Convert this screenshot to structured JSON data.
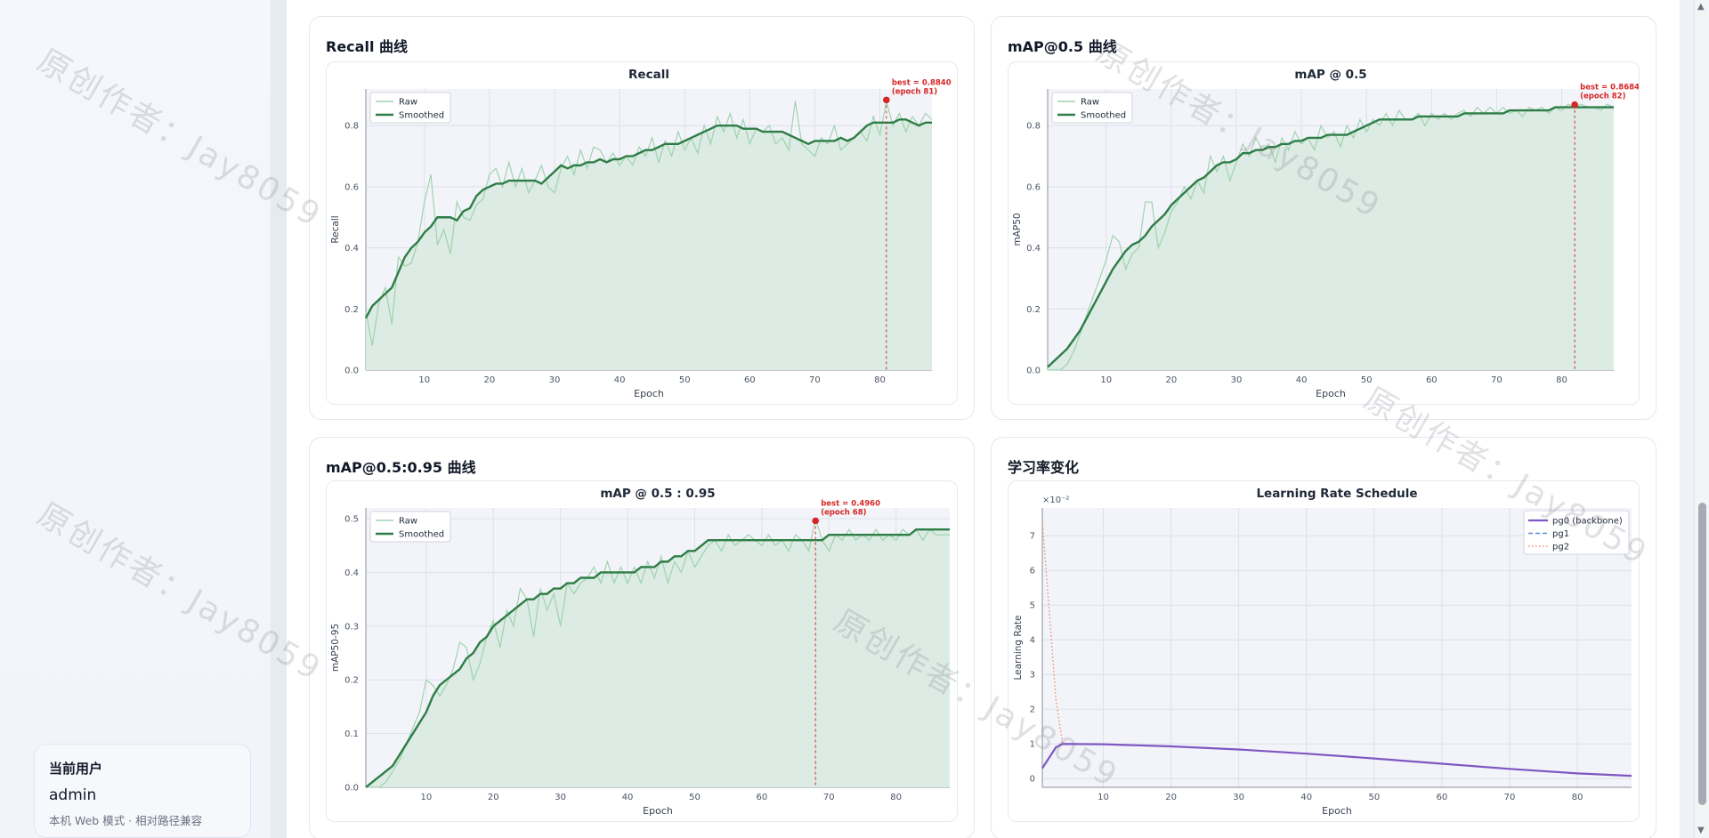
{
  "sidebar": {
    "user_title": "当前用户",
    "user_name": "admin",
    "user_mode": "本机 Web 模式 · 相对路径兼容"
  },
  "cards": {
    "recall": "Recall 曲线",
    "map50": "mAP@0.5 曲线",
    "map5095": "mAP@0.5:0.95 曲线",
    "lr": "学习率变化"
  },
  "watermark": "原创作者：Jay8059",
  "colors": {
    "raw": "#9fd3ae",
    "smoothed": "#2e7d46",
    "fill": "#dcebe3",
    "best": "#d62728",
    "pg0": "#7e57c2",
    "pg1": "#5b8bd6",
    "pg2": "#f08c6e",
    "plot_bg": "#f3f4f9"
  },
  "chart_data": [
    {
      "id": "recall",
      "type": "line",
      "title": "Recall",
      "xlabel": "Epoch",
      "ylabel": "Recall",
      "xlim": [
        1,
        88
      ],
      "ylim": [
        0,
        0.92
      ],
      "xticks": [
        10,
        20,
        30,
        40,
        50,
        60,
        70,
        80
      ],
      "yticks": [
        0.0,
        0.2,
        0.4,
        0.6,
        0.8
      ],
      "ytick_labels": [
        "0.0",
        "0.2",
        "0.4",
        "0.6",
        "0.8"
      ],
      "legend": [
        "Raw",
        "Smoothed"
      ],
      "legend_position": "top-left",
      "grid": true,
      "best": {
        "epoch": 81,
        "value": 0.884,
        "label1": "best = 0.8840",
        "label2": "(epoch 81)"
      },
      "series": [
        {
          "name": "Raw",
          "x_start": 1,
          "values": [
            0.19,
            0.08,
            0.22,
            0.27,
            0.15,
            0.37,
            0.34,
            0.35,
            0.42,
            0.55,
            0.64,
            0.41,
            0.46,
            0.38,
            0.55,
            0.5,
            0.49,
            0.54,
            0.56,
            0.64,
            0.66,
            0.6,
            0.68,
            0.6,
            0.66,
            0.58,
            0.62,
            0.67,
            0.6,
            0.58,
            0.66,
            0.7,
            0.64,
            0.72,
            0.66,
            0.73,
            0.72,
            0.68,
            0.71,
            0.67,
            0.7,
            0.67,
            0.73,
            0.7,
            0.76,
            0.68,
            0.75,
            0.7,
            0.78,
            0.72,
            0.76,
            0.71,
            0.8,
            0.74,
            0.83,
            0.78,
            0.84,
            0.76,
            0.82,
            0.74,
            0.79,
            0.78,
            0.8,
            0.74,
            0.76,
            0.72,
            0.88,
            0.74,
            0.72,
            0.7,
            0.76,
            0.74,
            0.8,
            0.72,
            0.74,
            0.76,
            0.78,
            0.75,
            0.83,
            0.77,
            0.88,
            0.8,
            0.84,
            0.78,
            0.83,
            0.8,
            0.84,
            0.82
          ]
        },
        {
          "name": "Smoothed",
          "x_start": 1,
          "values": [
            0.17,
            0.21,
            0.23,
            0.25,
            0.27,
            0.32,
            0.37,
            0.4,
            0.42,
            0.45,
            0.47,
            0.5,
            0.5,
            0.5,
            0.49,
            0.52,
            0.53,
            0.57,
            0.59,
            0.6,
            0.61,
            0.61,
            0.62,
            0.62,
            0.62,
            0.62,
            0.62,
            0.61,
            0.63,
            0.65,
            0.67,
            0.66,
            0.67,
            0.67,
            0.68,
            0.68,
            0.69,
            0.68,
            0.69,
            0.69,
            0.7,
            0.7,
            0.71,
            0.72,
            0.72,
            0.73,
            0.74,
            0.74,
            0.74,
            0.75,
            0.76,
            0.77,
            0.78,
            0.79,
            0.8,
            0.8,
            0.8,
            0.8,
            0.79,
            0.79,
            0.79,
            0.78,
            0.78,
            0.78,
            0.78,
            0.77,
            0.76,
            0.75,
            0.74,
            0.75,
            0.75,
            0.75,
            0.75,
            0.76,
            0.75,
            0.76,
            0.78,
            0.8,
            0.81,
            0.81,
            0.81,
            0.81,
            0.82,
            0.82,
            0.81,
            0.8,
            0.81,
            0.81
          ]
        }
      ]
    },
    {
      "id": "map50",
      "type": "line",
      "title": "mAP @ 0.5",
      "xlabel": "Epoch",
      "ylabel": "mAP50",
      "xlim": [
        1,
        88
      ],
      "ylim": [
        0,
        0.92
      ],
      "xticks": [
        10,
        20,
        30,
        40,
        50,
        60,
        70,
        80
      ],
      "yticks": [
        0.0,
        0.2,
        0.4,
        0.6,
        0.8
      ],
      "ytick_labels": [
        "0.0",
        "0.2",
        "0.4",
        "0.6",
        "0.8"
      ],
      "legend": [
        "Raw",
        "Smoothed"
      ],
      "legend_position": "top-left",
      "grid": true,
      "best": {
        "epoch": 82,
        "value": 0.8684,
        "label1": "best = 0.8684",
        "label2": "(epoch 82)"
      },
      "series": [
        {
          "name": "Raw",
          "x_start": 1,
          "values": [
            0.0,
            0.0,
            0.0,
            0.02,
            0.06,
            0.12,
            0.18,
            0.24,
            0.3,
            0.36,
            0.44,
            0.42,
            0.33,
            0.38,
            0.4,
            0.55,
            0.55,
            0.4,
            0.45,
            0.52,
            0.55,
            0.6,
            0.56,
            0.62,
            0.58,
            0.7,
            0.65,
            0.7,
            0.62,
            0.68,
            0.74,
            0.7,
            0.76,
            0.72,
            0.74,
            0.68,
            0.76,
            0.72,
            0.78,
            0.74,
            0.76,
            0.72,
            0.8,
            0.76,
            0.78,
            0.73,
            0.8,
            0.76,
            0.82,
            0.78,
            0.82,
            0.8,
            0.84,
            0.8,
            0.85,
            0.82,
            0.82,
            0.84,
            0.8,
            0.84,
            0.82,
            0.84,
            0.82,
            0.84,
            0.85,
            0.83,
            0.86,
            0.84,
            0.86,
            0.84,
            0.86,
            0.84,
            0.85,
            0.83,
            0.86,
            0.85,
            0.86,
            0.84,
            0.86,
            0.85,
            0.87,
            0.86,
            0.87,
            0.86,
            0.86,
            0.85,
            0.87,
            0.86
          ]
        },
        {
          "name": "Smoothed",
          "x_start": 1,
          "values": [
            0.01,
            0.03,
            0.05,
            0.07,
            0.1,
            0.13,
            0.17,
            0.21,
            0.25,
            0.29,
            0.33,
            0.36,
            0.39,
            0.41,
            0.42,
            0.44,
            0.47,
            0.49,
            0.51,
            0.54,
            0.56,
            0.58,
            0.6,
            0.62,
            0.63,
            0.65,
            0.67,
            0.68,
            0.68,
            0.69,
            0.71,
            0.71,
            0.72,
            0.72,
            0.73,
            0.73,
            0.74,
            0.74,
            0.75,
            0.75,
            0.76,
            0.76,
            0.76,
            0.77,
            0.77,
            0.77,
            0.77,
            0.78,
            0.79,
            0.8,
            0.81,
            0.82,
            0.82,
            0.82,
            0.82,
            0.82,
            0.82,
            0.83,
            0.83,
            0.83,
            0.83,
            0.83,
            0.83,
            0.83,
            0.84,
            0.84,
            0.84,
            0.84,
            0.84,
            0.84,
            0.84,
            0.85,
            0.85,
            0.85,
            0.85,
            0.85,
            0.85,
            0.85,
            0.86,
            0.86,
            0.86,
            0.86,
            0.86,
            0.86,
            0.86,
            0.86,
            0.86,
            0.86
          ]
        }
      ]
    },
    {
      "id": "map5095",
      "type": "line",
      "title": "mAP @ 0.5 : 0.95",
      "xlabel": "Epoch",
      "ylabel": "mAP50-95",
      "xlim": [
        1,
        88
      ],
      "ylim": [
        0,
        0.52
      ],
      "xticks": [
        10,
        20,
        30,
        40,
        50,
        60,
        70,
        80
      ],
      "yticks": [
        0.0,
        0.1,
        0.2,
        0.3,
        0.4,
        0.5
      ],
      "ytick_labels": [
        "0.0",
        "0.1",
        "0.2",
        "0.3",
        "0.4",
        "0.5"
      ],
      "legend": [
        "Raw",
        "Smoothed"
      ],
      "legend_position": "top-left",
      "grid": true,
      "best": {
        "epoch": 68,
        "value": 0.496,
        "label1": "best = 0.4960",
        "label2": "(epoch 68)"
      },
      "series": [
        {
          "name": "Raw",
          "x_start": 1,
          "values": [
            0.0,
            0.0,
            0.0,
            0.01,
            0.03,
            0.05,
            0.08,
            0.11,
            0.14,
            0.2,
            0.19,
            0.17,
            0.19,
            0.22,
            0.27,
            0.26,
            0.2,
            0.23,
            0.28,
            0.31,
            0.26,
            0.33,
            0.3,
            0.37,
            0.35,
            0.28,
            0.37,
            0.33,
            0.36,
            0.3,
            0.38,
            0.36,
            0.38,
            0.39,
            0.41,
            0.38,
            0.42,
            0.38,
            0.41,
            0.38,
            0.41,
            0.38,
            0.42,
            0.39,
            0.43,
            0.38,
            0.42,
            0.4,
            0.44,
            0.41,
            0.43,
            0.45,
            0.46,
            0.44,
            0.47,
            0.45,
            0.46,
            0.47,
            0.46,
            0.45,
            0.47,
            0.45,
            0.46,
            0.44,
            0.47,
            0.46,
            0.44,
            0.5,
            0.46,
            0.44,
            0.47,
            0.46,
            0.48,
            0.46,
            0.47,
            0.46,
            0.48,
            0.46,
            0.47,
            0.46,
            0.48,
            0.47,
            0.48,
            0.46,
            0.48,
            0.47,
            0.47,
            0.47
          ]
        },
        {
          "name": "Smoothed",
          "x_start": 1,
          "values": [
            0.0,
            0.01,
            0.02,
            0.03,
            0.04,
            0.06,
            0.08,
            0.1,
            0.12,
            0.14,
            0.17,
            0.19,
            0.2,
            0.21,
            0.22,
            0.24,
            0.25,
            0.27,
            0.28,
            0.3,
            0.31,
            0.32,
            0.33,
            0.34,
            0.35,
            0.35,
            0.36,
            0.36,
            0.37,
            0.37,
            0.38,
            0.38,
            0.39,
            0.39,
            0.39,
            0.4,
            0.4,
            0.4,
            0.4,
            0.4,
            0.4,
            0.41,
            0.41,
            0.41,
            0.42,
            0.42,
            0.43,
            0.43,
            0.44,
            0.44,
            0.45,
            0.46,
            0.46,
            0.46,
            0.46,
            0.46,
            0.46,
            0.46,
            0.46,
            0.46,
            0.46,
            0.46,
            0.46,
            0.46,
            0.46,
            0.46,
            0.46,
            0.46,
            0.46,
            0.47,
            0.47,
            0.47,
            0.47,
            0.47,
            0.47,
            0.47,
            0.47,
            0.47,
            0.47,
            0.47,
            0.47,
            0.47,
            0.48,
            0.48,
            0.48,
            0.48,
            0.48,
            0.48
          ]
        }
      ]
    },
    {
      "id": "lr",
      "type": "line",
      "title": "Learning Rate Schedule",
      "xlabel": "Epoch",
      "ylabel": "Learning Rate",
      "xlim": [
        1,
        88
      ],
      "ylim": [
        -0.25,
        7.8
      ],
      "y_scale_note": "×10⁻²",
      "xticks": [
        10,
        20,
        30,
        40,
        50,
        60,
        70,
        80
      ],
      "yticks": [
        0,
        1,
        2,
        3,
        4,
        5,
        6,
        7
      ],
      "ytick_labels": [
        "0",
        "1",
        "2",
        "3",
        "4",
        "5",
        "6",
        "7"
      ],
      "legend": [
        "pg0 (backbone)",
        "pg1",
        "pg2"
      ],
      "legend_position": "top-right",
      "grid": true,
      "series": [
        {
          "name": "pg0 (backbone)",
          "style": "solid",
          "points": [
            [
              1,
              0.3
            ],
            [
              2,
              0.6
            ],
            [
              3,
              0.9
            ],
            [
              4,
              1.0
            ],
            [
              10,
              0.99
            ],
            [
              20,
              0.93
            ],
            [
              30,
              0.84
            ],
            [
              40,
              0.72
            ],
            [
              50,
              0.58
            ],
            [
              60,
              0.43
            ],
            [
              70,
              0.28
            ],
            [
              80,
              0.15
            ],
            [
              88,
              0.08
            ]
          ]
        },
        {
          "name": "pg1",
          "style": "dashed",
          "points": [
            [
              1,
              0.3
            ],
            [
              2,
              0.6
            ],
            [
              3,
              0.9
            ],
            [
              4,
              1.0
            ],
            [
              10,
              0.99
            ],
            [
              20,
              0.93
            ],
            [
              30,
              0.84
            ],
            [
              40,
              0.72
            ],
            [
              50,
              0.58
            ],
            [
              60,
              0.43
            ],
            [
              70,
              0.28
            ],
            [
              80,
              0.15
            ],
            [
              88,
              0.08
            ]
          ]
        },
        {
          "name": "pg2",
          "style": "dotted",
          "points": [
            [
              1,
              7.4
            ],
            [
              2,
              4.9
            ],
            [
              3,
              2.3
            ],
            [
              4,
              1.0
            ],
            [
              10,
              0.99
            ],
            [
              20,
              0.93
            ],
            [
              30,
              0.84
            ],
            [
              40,
              0.72
            ],
            [
              50,
              0.58
            ],
            [
              60,
              0.43
            ],
            [
              70,
              0.28
            ],
            [
              80,
              0.15
            ],
            [
              88,
              0.08
            ]
          ]
        }
      ]
    }
  ]
}
